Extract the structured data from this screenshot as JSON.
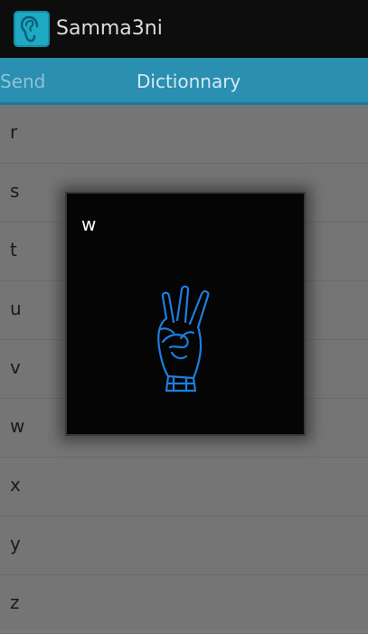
{
  "app": {
    "title": "Samma3ni",
    "icon": "ear-icon"
  },
  "tabs": [
    {
      "label": "Send"
    },
    {
      "label": "Dictionnary"
    }
  ],
  "list": {
    "items": [
      {
        "label": "r"
      },
      {
        "label": "s"
      },
      {
        "label": "t"
      },
      {
        "label": "u"
      },
      {
        "label": "v"
      },
      {
        "label": "w"
      },
      {
        "label": "x"
      },
      {
        "label": "y"
      },
      {
        "label": "z"
      }
    ]
  },
  "dialog": {
    "letter": "w",
    "image": "hand-sign-w-icon"
  },
  "colors": {
    "action_bar": "#0d0d0d",
    "tab_bar": "#2a8fb0",
    "dim_list": "#757575",
    "hand_stroke": "#1b7fe0"
  }
}
